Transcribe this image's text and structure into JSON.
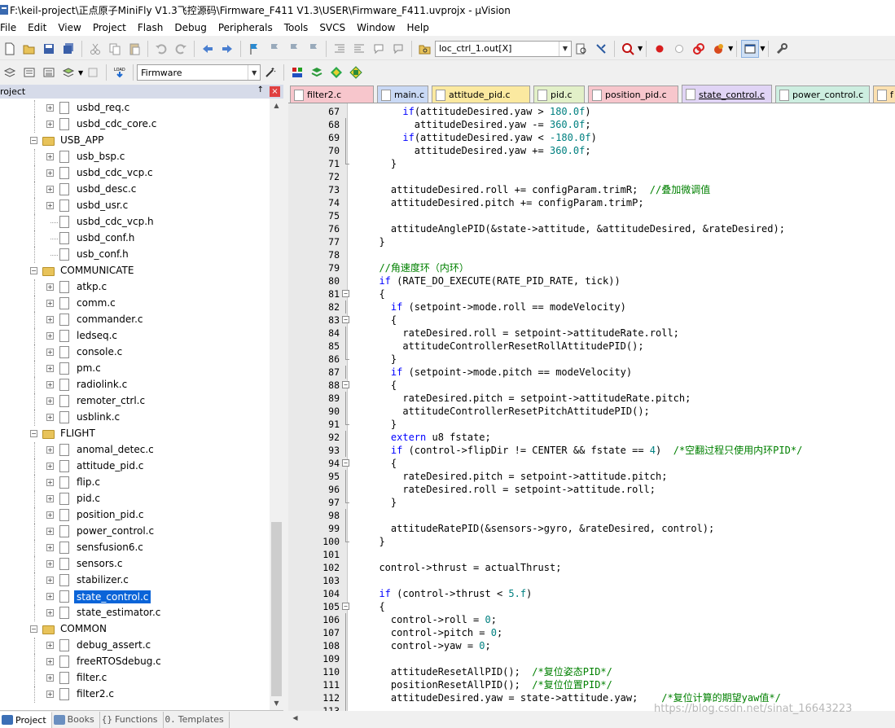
{
  "window": {
    "title": "F:\\keil-project\\正点原子MiniFly V1.3飞控源码\\Firmware_F411 V1.3\\USER\\Firmware_F411.uvprojx - µVision"
  },
  "menu": [
    "File",
    "Edit",
    "View",
    "Project",
    "Flash",
    "Debug",
    "Peripherals",
    "Tools",
    "SVCS",
    "Window",
    "Help"
  ],
  "toolbar": {
    "find_combo_value": "loc_ctrl_1.out[X]",
    "target_combo_value": "Firmware",
    "load_label": "LOAD"
  },
  "project_panel": {
    "title": "roject",
    "pin_glyph": "↑",
    "close_glyph": "×"
  },
  "tree": [
    {
      "type": "file",
      "label": "usbd_req.c",
      "expand": true
    },
    {
      "type": "file",
      "label": "usbd_cdc_core.c",
      "expand": true
    },
    {
      "type": "folder",
      "label": "USB_APP"
    },
    {
      "type": "file",
      "label": "usb_bsp.c",
      "expand": true
    },
    {
      "type": "file",
      "label": "usbd_cdc_vcp.c",
      "expand": true
    },
    {
      "type": "file",
      "label": "usbd_desc.c",
      "expand": true
    },
    {
      "type": "file",
      "label": "usbd_usr.c",
      "expand": true
    },
    {
      "type": "file",
      "label": "usbd_cdc_vcp.h",
      "expand": false
    },
    {
      "type": "file",
      "label": "usbd_conf.h",
      "expand": false
    },
    {
      "type": "file",
      "label": "usb_conf.h",
      "expand": false
    },
    {
      "type": "folder",
      "label": "COMMUNICATE"
    },
    {
      "type": "file",
      "label": "atkp.c",
      "expand": true
    },
    {
      "type": "file",
      "label": "comm.c",
      "expand": true
    },
    {
      "type": "file",
      "label": "commander.c",
      "expand": true
    },
    {
      "type": "file",
      "label": "ledseq.c",
      "expand": true
    },
    {
      "type": "file",
      "label": "console.c",
      "expand": true
    },
    {
      "type": "file",
      "label": "pm.c",
      "expand": true
    },
    {
      "type": "file",
      "label": "radiolink.c",
      "expand": true
    },
    {
      "type": "file",
      "label": "remoter_ctrl.c",
      "expand": true
    },
    {
      "type": "file",
      "label": "usblink.c",
      "expand": true
    },
    {
      "type": "folder",
      "label": "FLIGHT"
    },
    {
      "type": "file",
      "label": "anomal_detec.c",
      "expand": true
    },
    {
      "type": "file",
      "label": "attitude_pid.c",
      "expand": true
    },
    {
      "type": "file",
      "label": "flip.c",
      "expand": true
    },
    {
      "type": "file",
      "label": "pid.c",
      "expand": true
    },
    {
      "type": "file",
      "label": "position_pid.c",
      "expand": true
    },
    {
      "type": "file",
      "label": "power_control.c",
      "expand": true
    },
    {
      "type": "file",
      "label": "sensfusion6.c",
      "expand": true
    },
    {
      "type": "file",
      "label": "sensors.c",
      "expand": true
    },
    {
      "type": "file",
      "label": "stabilizer.c",
      "expand": true
    },
    {
      "type": "file",
      "label": "state_control.c",
      "expand": true,
      "selected": true
    },
    {
      "type": "file",
      "label": "state_estimator.c",
      "expand": true
    },
    {
      "type": "folder",
      "label": "COMMON"
    },
    {
      "type": "file",
      "label": "debug_assert.c",
      "expand": true
    },
    {
      "type": "file",
      "label": "freeRTOSdebug.c",
      "expand": true
    },
    {
      "type": "file",
      "label": "filter.c",
      "expand": true
    },
    {
      "type": "file",
      "label": "filter2.c",
      "expand": true
    }
  ],
  "panel_tabs": [
    {
      "label": "Project",
      "active": true,
      "color": "#3b6fb6"
    },
    {
      "label": "Books",
      "active": false,
      "color": "#6a8fc0"
    },
    {
      "label": "Functions",
      "active": false,
      "color": "#555555"
    },
    {
      "label": "Templates",
      "active": false,
      "color": "#555555"
    }
  ],
  "editor_tabs": [
    {
      "label": "filter2.c",
      "color": "#f7c6cc",
      "active": false
    },
    {
      "label": "main.c",
      "color": "#c9d9f5",
      "active": false
    },
    {
      "label": "attitude_pid.c",
      "color": "#fbe9a0",
      "active": false
    },
    {
      "label": "pid.c",
      "color": "#e2f0c8",
      "active": false
    },
    {
      "label": "position_pid.c",
      "color": "#f7c6cc",
      "active": false
    },
    {
      "label": "state_control.c",
      "color": "#e0d4f5",
      "active": true
    },
    {
      "label": "power_control.c",
      "color": "#cdeee0",
      "active": false
    },
    {
      "label": "f",
      "color": "#fbe0b0",
      "active": false
    }
  ],
  "code": [
    {
      "n": "67",
      "t": "      <k>if</k>(attitudeDesired.yaw &gt; <m>180.0f</m>)"
    },
    {
      "n": "68",
      "t": "        attitudeDesired.yaw -= <m>360.0f</m>;"
    },
    {
      "n": "69",
      "t": "      <k>if</k>(attitudeDesired.yaw &lt; <m>-180.0f</m>)"
    },
    {
      "n": "70",
      "t": "        attitudeDesired.yaw += <m>360.0f</m>;"
    },
    {
      "n": "71",
      "t": "    }"
    },
    {
      "n": "72",
      "t": ""
    },
    {
      "n": "73",
      "t": "    attitudeDesired.roll += configParam.trimR;  <c>//叠加微调值</c>"
    },
    {
      "n": "74",
      "t": "    attitudeDesired.pitch += configParam.trimP;"
    },
    {
      "n": "75",
      "t": ""
    },
    {
      "n": "76",
      "t": "    attitudeAnglePID(&amp;state-&gt;attitude, &amp;attitudeDesired, &amp;rateDesired);"
    },
    {
      "n": "77",
      "t": "  }"
    },
    {
      "n": "78",
      "t": ""
    },
    {
      "n": "79",
      "t": "  <c>//角速度环（内环）</c>"
    },
    {
      "n": "80",
      "t": "  <k>if</k> (RATE_DO_EXECUTE(RATE_PID_RATE, tick))"
    },
    {
      "n": "81",
      "t": "  {"
    },
    {
      "n": "82",
      "t": "    <k>if</k> (setpoint-&gt;mode.roll == modeVelocity)"
    },
    {
      "n": "83",
      "t": "    {"
    },
    {
      "n": "84",
      "t": "      rateDesired.roll = setpoint-&gt;attitudeRate.roll;"
    },
    {
      "n": "85",
      "t": "      attitudeControllerResetRollAttitudePID();"
    },
    {
      "n": "86",
      "t": "    }"
    },
    {
      "n": "87",
      "t": "    <k>if</k> (setpoint-&gt;mode.pitch == modeVelocity)"
    },
    {
      "n": "88",
      "t": "    {"
    },
    {
      "n": "89",
      "t": "      rateDesired.pitch = setpoint-&gt;attitudeRate.pitch;"
    },
    {
      "n": "90",
      "t": "      attitudeControllerResetPitchAttitudePID();"
    },
    {
      "n": "91",
      "t": "    }"
    },
    {
      "n": "92",
      "t": "    <k>extern</k> u8 fstate;"
    },
    {
      "n": "93",
      "t": "    <k>if</k> (control-&gt;flipDir != CENTER &amp;&amp; fstate == <m>4</m>)  <c>/*空翻过程只使用内环PID*/</c>"
    },
    {
      "n": "94",
      "t": "    {"
    },
    {
      "n": "95",
      "t": "      rateDesired.pitch = setpoint-&gt;attitude.pitch;"
    },
    {
      "n": "96",
      "t": "      rateDesired.roll = setpoint-&gt;attitude.roll;"
    },
    {
      "n": "97",
      "t": "    }"
    },
    {
      "n": "98",
      "t": ""
    },
    {
      "n": "99",
      "t": "    attitudeRatePID(&amp;sensors-&gt;gyro, &amp;rateDesired, control);"
    },
    {
      "n": "100",
      "t": "  }"
    },
    {
      "n": "101",
      "t": ""
    },
    {
      "n": "102",
      "t": "  control-&gt;thrust = actualThrust;"
    },
    {
      "n": "103",
      "t": ""
    },
    {
      "n": "104",
      "t": "  <k>if</k> (control-&gt;thrust &lt; <m>5.f</m>)"
    },
    {
      "n": "105",
      "t": "  {"
    },
    {
      "n": "106",
      "t": "    control-&gt;roll = <m>0</m>;"
    },
    {
      "n": "107",
      "t": "    control-&gt;pitch = <m>0</m>;"
    },
    {
      "n": "108",
      "t": "    control-&gt;yaw = <m>0</m>;"
    },
    {
      "n": "109",
      "t": ""
    },
    {
      "n": "110",
      "t": "    attitudeResetAllPID();  <c>/*复位姿态PID*/</c>"
    },
    {
      "n": "111",
      "t": "    positionResetAllPID();  <c>/*复位位置PID*/</c>"
    },
    {
      "n": "112",
      "t": "    attitudeDesired.yaw = state-&gt;attitude.yaw;    <c>/*复位计算的期望yaw值*/</c>"
    },
    {
      "n": "113",
      "t": ""
    }
  ],
  "watermark": "https://blog.csdn.net/sinat_16643223"
}
